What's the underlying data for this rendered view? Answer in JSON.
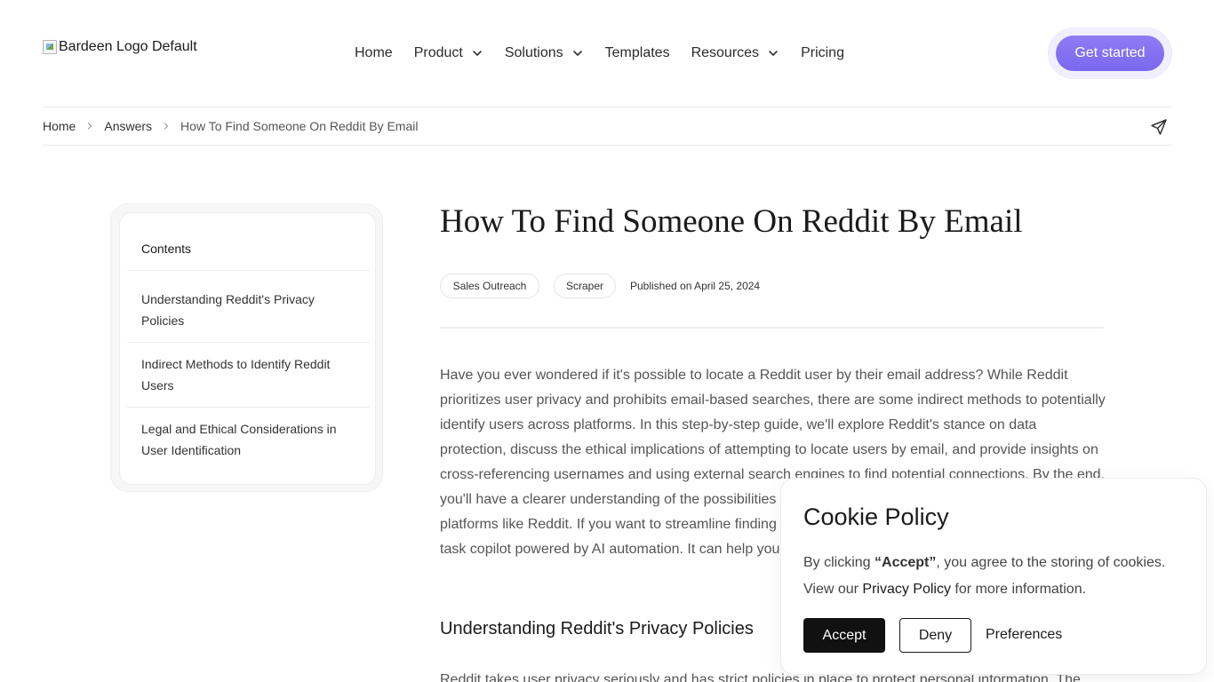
{
  "header": {
    "logo_alt": "Bardeen Logo Default",
    "nav": [
      {
        "label": "Home",
        "has_dropdown": false
      },
      {
        "label": "Product",
        "has_dropdown": true
      },
      {
        "label": "Solutions",
        "has_dropdown": true
      },
      {
        "label": "Templates",
        "has_dropdown": false
      },
      {
        "label": "Resources",
        "has_dropdown": true
      },
      {
        "label": "Pricing",
        "has_dropdown": false
      }
    ],
    "cta_label": "Get started",
    "cta_color": "#7b68ee"
  },
  "breadcrumb": {
    "items": [
      "Home",
      "Answers",
      "How To Find Someone On Reddit By Email"
    ],
    "share_icon": "send-icon"
  },
  "toc": {
    "title": "Contents",
    "items": [
      "Understanding Reddit's Privacy Policies",
      "Indirect Methods to Identify Reddit Users",
      "Legal and Ethical Considerations in User Identification"
    ]
  },
  "article": {
    "title": "How To Find Someone On Reddit By Email",
    "tags": [
      "Sales Outreach",
      "Scraper"
    ],
    "published": "Published on April 25, 2024",
    "intro": "Have you ever wondered if it's possible to locate a Reddit user by their email address? While Reddit prioritizes user privacy and prohibits email-based searches, there are some indirect methods to potentially identify users across platforms. In this step-by-step guide, we'll explore Reddit's stance on data protection, discuss the ethical implications of attempting to locate users by email, and provide insights on cross-referencing usernames and using external search engines to find potential connections. By the end, you'll have a clearer understanding of the possibilities and limitations surrounding user identification on platforms like Reddit. If you want to streamline finding Reddit users using email addresses, Bardeen is a task copilot powered by AI automation. It can help you to automate repetitive tasks with just a few clicks.",
    "section_heading": "Understanding Reddit's Privacy Policies",
    "section_text": "Reddit takes user privacy seriously and has strict policies in place to protect personal information. The"
  },
  "cookie": {
    "title": "Cookie Policy",
    "text_prefix": "By clicking ",
    "text_bold": "“Accept”",
    "text_middle": ", you agree to the storing of cookies. View our ",
    "link_label": "Privacy Policy",
    "text_suffix": " for more information.",
    "accept_label": "Accept",
    "deny_label": "Deny",
    "preferences_label": "Preferences"
  }
}
